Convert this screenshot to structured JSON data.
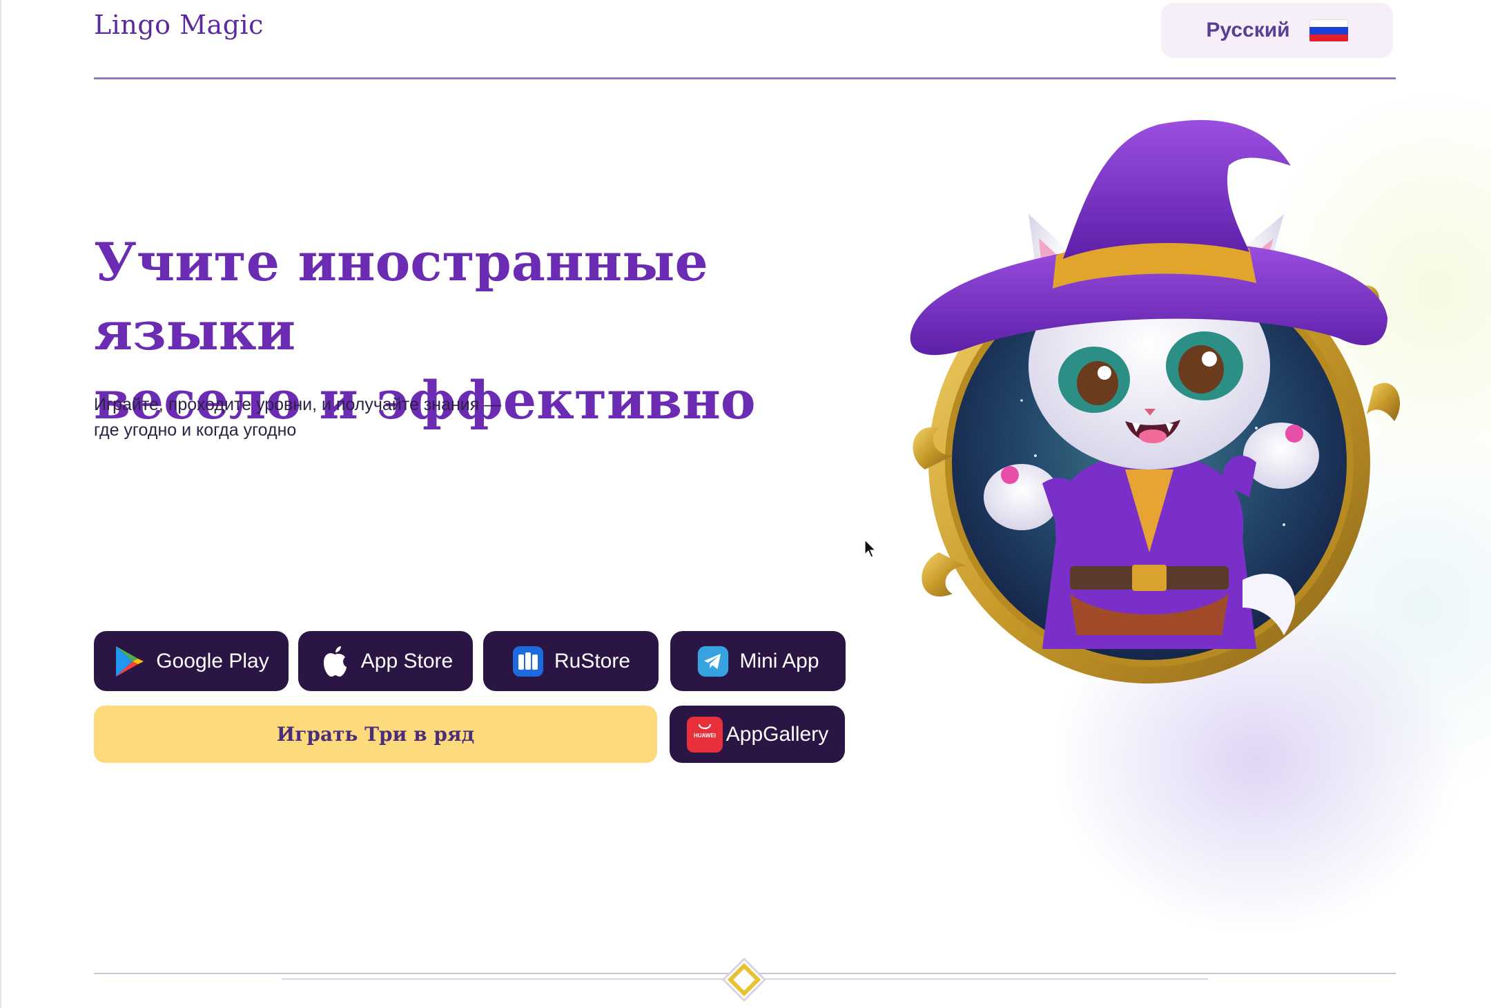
{
  "header": {
    "logo": "Lingo Magic",
    "language": {
      "label": "Русский",
      "flag": "russia-flag",
      "flag_colors": [
        "#ffffff",
        "#1c3fd6",
        "#e3202a"
      ]
    }
  },
  "hero": {
    "title_line1": "Учите иностранные языки",
    "title_line2": "весело и эффективно",
    "subtitle_line1": "Играйте, проходите уровни, и получайте знания —",
    "subtitle_line2": "где угодно и когда угодно",
    "illustration": "wizard-cat-mascot"
  },
  "stores": {
    "google_play": {
      "label": "Google Play",
      "icon": "google-play-icon"
    },
    "app_store": {
      "label": "App Store",
      "icon": "apple-icon"
    },
    "rustore": {
      "label": "RuStore",
      "icon": "rustore-icon"
    },
    "mini_app": {
      "label": "Mini App",
      "icon": "telegram-icon"
    },
    "app_gallery": {
      "label": "AppGallery",
      "icon": "huawei-icon",
      "icon_text": "HUAWEI"
    }
  },
  "play_button": {
    "label": "Играть Три в ряд"
  },
  "colors": {
    "brand_purple": "#6b2bb3",
    "button_dark": "#2b1545",
    "play_yellow": "#fdda7c",
    "accent_gold": "#e8c233"
  }
}
